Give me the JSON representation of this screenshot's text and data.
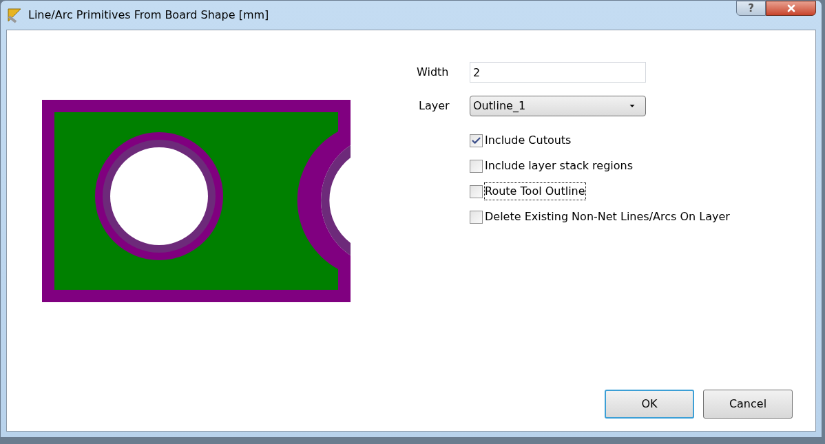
{
  "window": {
    "title": "Line/Arc Primitives From Board Shape [mm]",
    "help": "?"
  },
  "width": {
    "label": "Width",
    "value": "2"
  },
  "layer": {
    "label": "Layer",
    "value": "Outline_1"
  },
  "options": [
    {
      "label": "Include Cutouts",
      "checked": true,
      "focused": false
    },
    {
      "label": "Include layer stack regions",
      "checked": false,
      "focused": false
    },
    {
      "label": "Route Tool Outline",
      "checked": false,
      "focused": true
    },
    {
      "label": "Delete Existing Non-Net Lines/Arcs On Layer",
      "checked": false,
      "focused": false
    }
  ],
  "buttons": [
    {
      "label": "OK",
      "default": true
    },
    {
      "label": "Cancel",
      "default": false
    }
  ]
}
